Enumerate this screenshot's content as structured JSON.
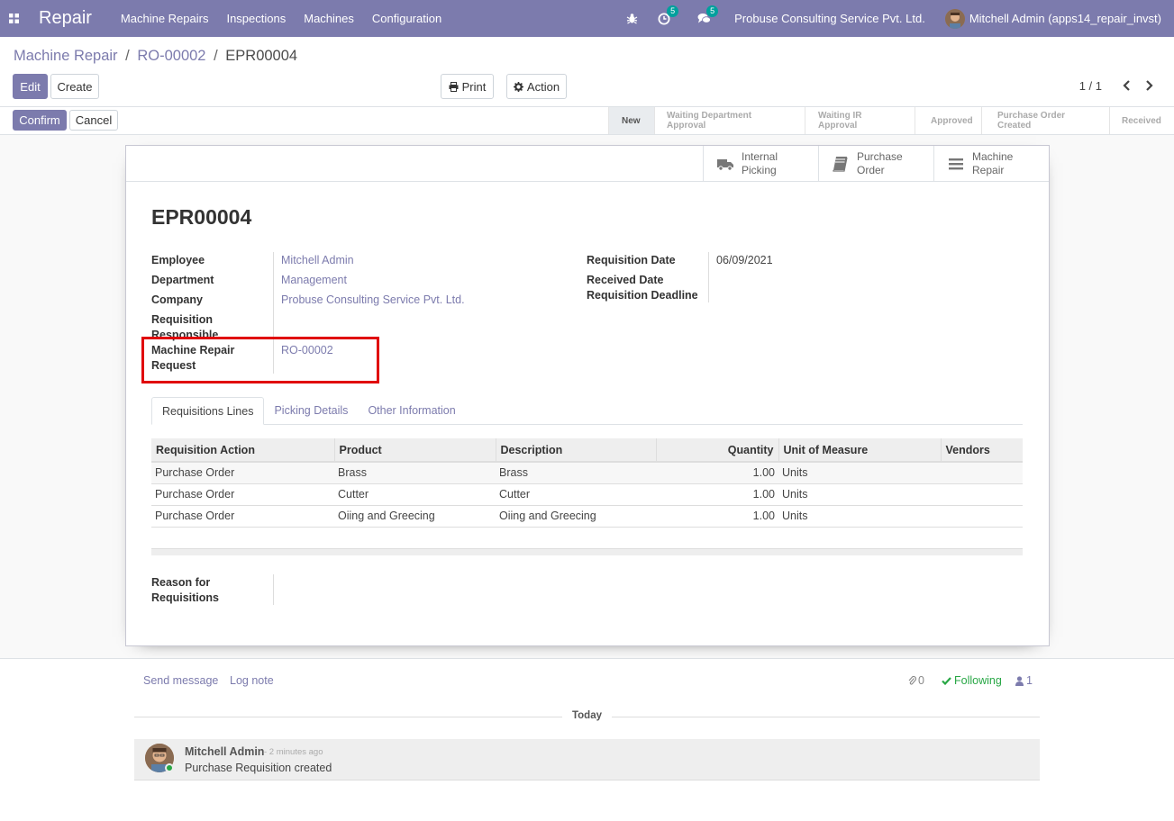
{
  "navbar": {
    "app_name": "Repair",
    "menu": [
      "Machine Repairs",
      "Inspections",
      "Machines",
      "Configuration"
    ],
    "activity_count": "5",
    "message_count": "5",
    "company": "Probuse Consulting Service Pvt. Ltd.",
    "user": "Mitchell Admin (apps14_repair_invst)"
  },
  "breadcrumb": {
    "part1": "Machine Repair",
    "part2": "RO-00002",
    "current": "EPR00004",
    "sep": "/"
  },
  "toolbar": {
    "edit": "Edit",
    "create": "Create",
    "print": "Print",
    "action": "Action",
    "pager": "1 / 1"
  },
  "statusbar": {
    "confirm": "Confirm",
    "cancel": "Cancel",
    "stages": [
      "New",
      "Waiting Department Approval",
      "Waiting IR Approval",
      "Approved",
      "Purchase Order Created",
      "Received"
    ],
    "active_stage": "New"
  },
  "smart_buttons": [
    {
      "line1": "Internal",
      "line2": "Picking",
      "icon": "truck-icon"
    },
    {
      "line1": "Purchase",
      "line2": "Order",
      "icon": "book-icon"
    },
    {
      "line1": "Machine",
      "line2": "Repair",
      "icon": "bars-icon"
    }
  ],
  "form": {
    "title": "EPR00004",
    "left_fields": {
      "employee_label": "Employee",
      "employee_value": "Mitchell Admin",
      "department_label": "Department",
      "department_value": "Management",
      "company_label": "Company",
      "company_value": "Probuse Consulting Service Pvt. Ltd.",
      "responsible_label_1": "Requisition",
      "responsible_label_2": "Responsible",
      "repair_label_1": "Machine Repair",
      "repair_label_2": "Request",
      "repair_value": "RO-00002"
    },
    "right_fields": {
      "req_date_label": "Requisition Date",
      "req_date_value": "06/09/2021",
      "received_label": "Received Date",
      "deadline_label": "Requisition Deadline"
    },
    "tabs": [
      "Requisitions Lines",
      "Picking Details",
      "Other Information"
    ],
    "table": {
      "headers": [
        "Requisition Action",
        "Product",
        "Description",
        "Quantity",
        "Unit of Measure",
        "Vendors"
      ],
      "rows": [
        [
          "Purchase Order",
          "Brass",
          "Brass",
          "1.00",
          "Units",
          ""
        ],
        [
          "Purchase Order",
          "Cutter",
          "Cutter",
          "1.00",
          "Units",
          ""
        ],
        [
          "Purchase Order",
          "Oiing and Greecing",
          "Oiing and Greecing",
          "1.00",
          "Units",
          ""
        ]
      ]
    },
    "reason_label_1": "Reason for",
    "reason_label_2": "Requisitions"
  },
  "chatter": {
    "send_message": "Send message",
    "log_note": "Log note",
    "attachments": "0",
    "following": "Following",
    "followers": "1",
    "today": "Today",
    "message": {
      "author": "Mitchell Admin",
      "time": "- 2 minutes ago",
      "body": "Purchase Requisition created"
    }
  },
  "colors": {
    "brand": "#7c7bad",
    "highlight": "#e0040b",
    "follow": "#28a745",
    "badge": "#00a09d"
  }
}
